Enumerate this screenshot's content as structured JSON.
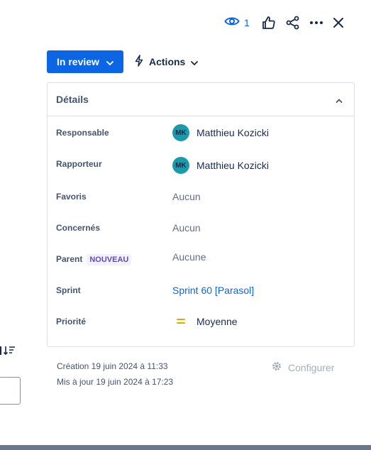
{
  "toolbar": {
    "watchers_count": "1",
    "icons": [
      "eye-icon",
      "like-icon",
      "share-icon",
      "more-icon",
      "close-icon"
    ]
  },
  "status": {
    "label": "In review"
  },
  "actions": {
    "label": "Actions"
  },
  "details": {
    "title": "Détails",
    "fields": {
      "assignee": {
        "label": "Responsable",
        "initials": "MK",
        "name": "Matthieu Kozicki"
      },
      "reporter": {
        "label": "Rapporteur",
        "initials": "MK",
        "name": "Matthieu Kozicki"
      },
      "favorites": {
        "label": "Favoris",
        "value": "Aucun"
      },
      "watchers": {
        "label": "Concernés",
        "value": "Aucun"
      },
      "parent": {
        "label": "Parent",
        "badge": "NOUVEAU",
        "value": "Aucune"
      },
      "sprint": {
        "label": "Sprint",
        "value": "Sprint 60 [Parasol]"
      },
      "priority": {
        "label": "Priorité",
        "value": "Moyenne"
      }
    }
  },
  "meta": {
    "created": "Création 19 juin 2024 à 11:33",
    "updated": "Mis à jour 19 juin 2024 à 17:23"
  },
  "configure": {
    "label": "Configurer"
  },
  "colors": {
    "primary": "#0c66e4",
    "avatar_bg": "#1d9aaa",
    "priority_medium": "#e2a800",
    "badge_bg": "#f3f0ff",
    "badge_text": "#5e4db2"
  }
}
